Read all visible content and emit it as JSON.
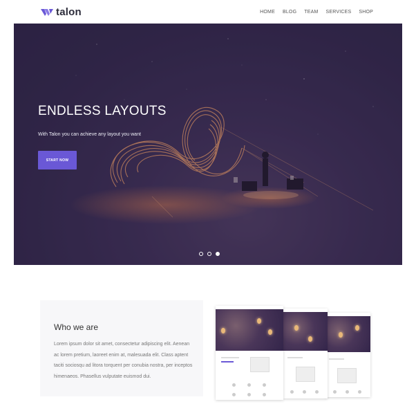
{
  "brand": {
    "name": "talon",
    "accent": "#6a58d6"
  },
  "nav": {
    "items": [
      "HOME",
      "BLOG",
      "TEAM",
      "SERVICES",
      "SHOP"
    ]
  },
  "hero": {
    "title": "ENDLESS LAYOUTS",
    "subtitle": "With Talon you can achieve any layout you want",
    "button_label": "START NOW",
    "slides": 3,
    "active_slide": 3
  },
  "about": {
    "title": "Who we are",
    "text": "Lorem ipsum dolor sit amet, consectetur adipiscing elit. Aenean ac lorem pretium, laoreet enim at, malesuada elit. Class aptent taciti sociosqu ad litora torquent per conubia nostra, per inceptos himenaeos. Phasellus vulputate euismod dui."
  },
  "colors": {
    "hero_bg": "#2f2547",
    "button": "#6a58d6",
    "card_bg": "#f7f7f9"
  }
}
